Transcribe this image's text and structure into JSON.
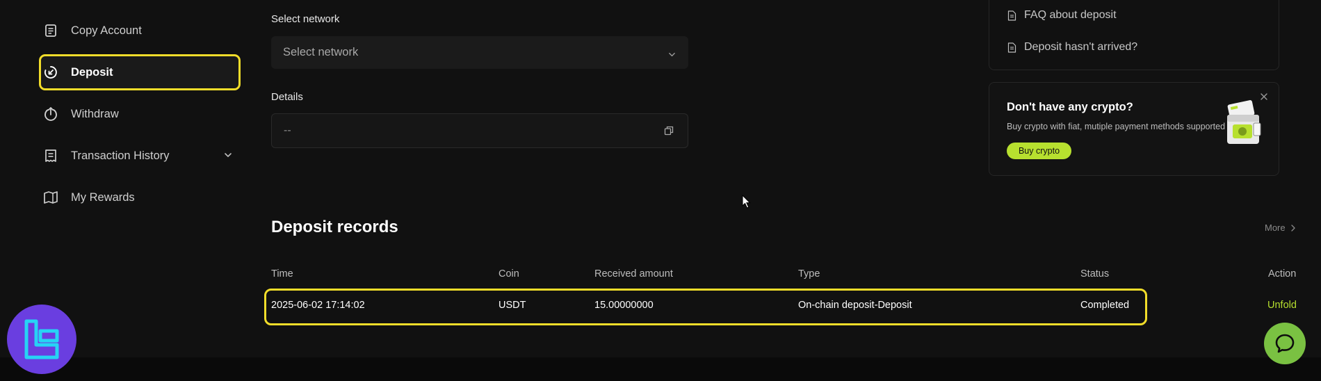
{
  "sidebar": {
    "items": [
      {
        "label": "Copy Account",
        "icon": "copy-account-icon"
      },
      {
        "label": "Deposit",
        "icon": "deposit-icon",
        "active": true
      },
      {
        "label": "Withdraw",
        "icon": "withdraw-icon"
      },
      {
        "label": "Transaction History",
        "icon": "receipt-icon",
        "has_submenu": true
      },
      {
        "label": "My Rewards",
        "icon": "rewards-icon"
      }
    ]
  },
  "form": {
    "network_label": "Select network",
    "network_placeholder": "Select network",
    "details_label": "Details",
    "details_value": "--"
  },
  "help": {
    "links": [
      {
        "label": "FAQ about deposit",
        "icon": "document-icon"
      },
      {
        "label": "Deposit hasn't arrived?",
        "icon": "document-icon"
      }
    ]
  },
  "promo": {
    "title": "Don't have any crypto?",
    "subtitle": "Buy crypto with fiat, mutiple payment methods supported",
    "button_label": "Buy crypto"
  },
  "records": {
    "title": "Deposit records",
    "more_label": "More",
    "columns": [
      "Time",
      "Coin",
      "Received amount",
      "Type",
      "Status",
      "Action"
    ],
    "rows": [
      {
        "time": "2025-06-02 17:14:02",
        "coin": "USDT",
        "amount": "15.00000000",
        "type": "On-chain deposit-Deposit",
        "status": "Completed",
        "action": "Unfold"
      }
    ]
  },
  "colors": {
    "accent_green": "#b7e02f",
    "highlight_yellow": "#f2dd2a",
    "background": "#111111"
  }
}
